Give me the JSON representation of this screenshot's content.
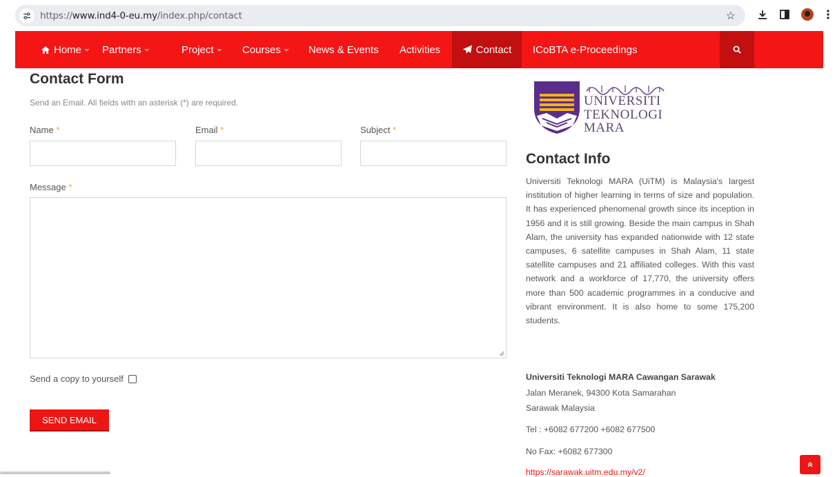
{
  "browser": {
    "url_scheme": "https://",
    "url_host": "www.ind4-0-eu.my",
    "url_path": "/index.php/contact"
  },
  "nav": {
    "items": [
      {
        "label": "Home",
        "icon": "home-icon",
        "caret": true
      },
      {
        "label": "Partners",
        "caret": true
      },
      {
        "label": "Project",
        "caret": true
      },
      {
        "label": "Courses",
        "caret": true
      },
      {
        "label": "News & Events",
        "caret": false
      },
      {
        "label": "Activities",
        "caret": false
      },
      {
        "label": "Contact",
        "icon": "paper-plane-icon",
        "caret": false,
        "active": true
      },
      {
        "label": "ICoBTA e-Proceedings",
        "caret": false
      }
    ],
    "search_icon": "search-icon",
    "color": "#f41515",
    "active_color": "#c20f0f"
  },
  "form": {
    "title": "Contact Form",
    "subtitle": "Send an Email. All fields with an asterisk (*) are required.",
    "name_label": "Name",
    "email_label": "Email",
    "subject_label": "Subject",
    "message_label": "Message",
    "required_marker": "*",
    "name_value": "",
    "email_value": "",
    "subject_value": "",
    "message_value": "",
    "copy_label": "Send a copy to yourself",
    "copy_checked": false,
    "submit_label": "SEND EMAIL"
  },
  "sidebar": {
    "logo": {
      "line1": "UNIVERSITI",
      "line2": "TEKNOLOGI",
      "line3": "MARA"
    },
    "info_title": "Contact Info",
    "info_text": "Universiti Teknologi MARA (UiTM) is Malaysia's largest institution of higher learning in terms of size and population. It has experienced phenomenal growth since its inception in 1956 and it is still growing. Beside the main campus in Shah Alam, the university has expanded nationwide with 12 state campuses, 6 satellite campuses in Shah Alam, 11 state satellite campuses and 21 affiliated colleges. With this vast network and a workforce of 17,770, the university offers more than 500 academic programmes in a conducive and vibrant environment. It is also home to some 175,200 students.",
    "address_name": "Universiti Teknologi MARA Cawangan Sarawak",
    "address_line1": "Jalan Meranek, 94300 Kota Samarahan",
    "address_line2": "Sarawak Malaysia",
    "tel": "Tel  : +6082 677200  +6082 677500",
    "fax": "No Fax: +6082 677300",
    "website": "https://sarawak.uitm.edu.my/v2/"
  },
  "colors": {
    "brand_red": "#ee1515",
    "required": "#f0a33a"
  }
}
